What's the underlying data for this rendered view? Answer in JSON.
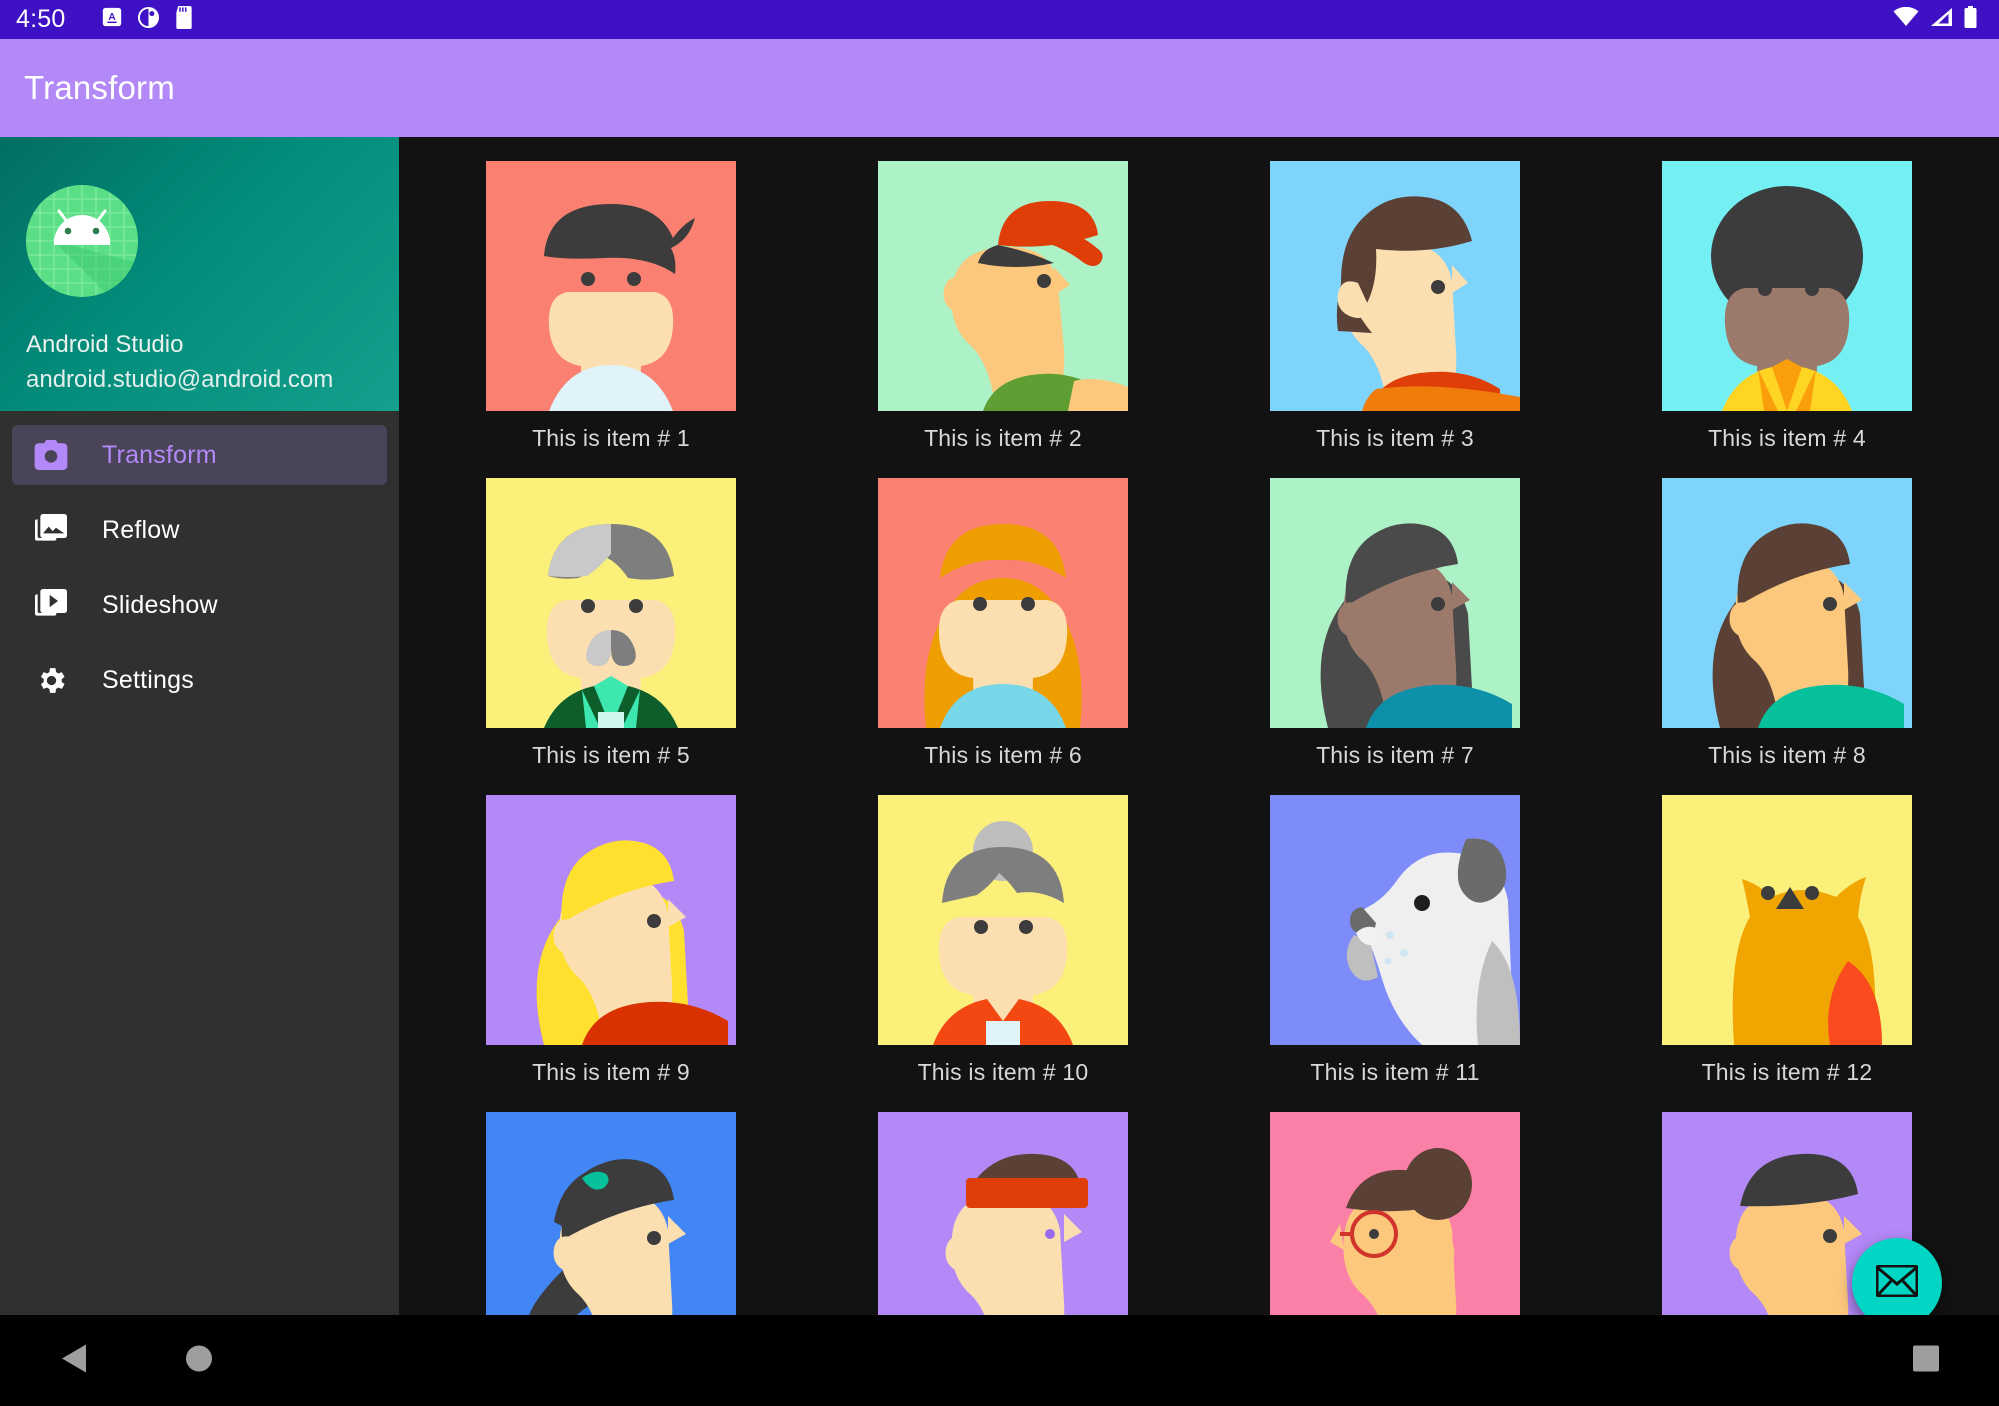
{
  "status_bar": {
    "clock": "4:50",
    "left_icons": [
      "alarm-letter-icon",
      "contrast-circle-icon",
      "sd-card-icon"
    ],
    "right_icons": [
      "wifi-icon",
      "cell-signal-icon",
      "battery-icon"
    ],
    "background_color": "#3F11C4"
  },
  "app_bar": {
    "title": "Transform",
    "background_color": "#B388F7",
    "title_color": "#FFFFFF"
  },
  "drawer": {
    "background_color": "#303030",
    "header": {
      "account_name": "Android Studio",
      "account_email": "android.studio@android.com",
      "logo_icon": "android-studio-logo",
      "gradient_from": "#016E62",
      "gradient_to": "#14A08C"
    },
    "items": [
      {
        "label": "Transform",
        "icon": "camera-icon",
        "selected": true
      },
      {
        "label": "Reflow",
        "icon": "photo-library-icon",
        "selected": false
      },
      {
        "label": "Slideshow",
        "icon": "video-library-icon",
        "selected": false
      },
      {
        "label": "Settings",
        "icon": "gear-icon",
        "selected": false
      }
    ],
    "selected_item_background": "#4A4458",
    "selected_item_color": "#B388F7"
  },
  "grid": {
    "items": [
      {
        "caption": "This is item # 1",
        "bg": "#FA8072",
        "kind": "front-quiff",
        "hair": "#3C3C3C",
        "skin": "#FCDFB0",
        "shirt": "#DFF3F9"
      },
      {
        "caption": "This is item # 2",
        "bg": "#ADF2C7",
        "kind": "profile-cap",
        "hair": "#3C3C3C",
        "skin": "#FCC87E",
        "shirt": "#5E9E32",
        "accent": "#E03E09"
      },
      {
        "caption": "This is item # 3",
        "bg": "#7FD4FB",
        "kind": "profile-bob",
        "hair": "#5B4036",
        "skin": "#FCDFB0",
        "shirt": "#F07C0B",
        "accent": "#E03E09"
      },
      {
        "caption": "This is item # 4",
        "bg": "#74F0F5",
        "kind": "front-afro",
        "hair": "#3C3C3C",
        "skin": "#9C7A6B",
        "shirt": "#FFD524",
        "accent": "#FA9E0C"
      },
      {
        "caption": "This is item # 5",
        "bg": "#FAF07A",
        "kind": "front-mustache",
        "hair": "#7E7E7E",
        "skin": "#FCDFB0",
        "shirt": "#0D5E2A",
        "accent": "#3EE6B0"
      },
      {
        "caption": "This is item # 6",
        "bg": "#FA8072",
        "kind": "front-long",
        "hair": "#EE9E00",
        "skin": "#FCDFB0",
        "shirt": "#77D7E8"
      },
      {
        "caption": "This is item # 7",
        "bg": "#ADF2C7",
        "kind": "profile-long",
        "hair": "#4A4A4A",
        "skin": "#9C7A6B",
        "shirt": "#0E90A8"
      },
      {
        "caption": "This is item # 8",
        "bg": "#7FD4FB",
        "kind": "profile-long",
        "hair": "#5B4036",
        "skin": "#FCC87E",
        "shirt": "#05C09A"
      },
      {
        "caption": "This is item # 9",
        "bg": "#B388F7",
        "kind": "profile-long",
        "hair": "#FFE02E",
        "skin": "#FCDFB0",
        "shirt": "#D93200"
      },
      {
        "caption": "This is item # 10",
        "bg": "#FAF07A",
        "kind": "front-bun",
        "hair": "#7E7E7E",
        "skin": "#FCDFB0",
        "shirt": "#F44813",
        "accent": "#DFF3F9"
      },
      {
        "caption": "This is item # 11",
        "bg": "#7E8CFA",
        "kind": "dog",
        "hair": "#6B6B6B",
        "skin": "#EFEFEF",
        "shirt": "#BFBFBF"
      },
      {
        "caption": "This is item # 12",
        "bg": "#FAF07A",
        "kind": "owl",
        "hair": "#3C3C3C",
        "skin": "#F0A500",
        "shirt": "#FA4B1E"
      },
      {
        "caption": "",
        "bg": "#4285F4",
        "kind": "profile-pony",
        "hair": "#3C3C3C",
        "skin": "#FCDFB0",
        "shirt": "#F44813",
        "accent": "#05C09A"
      },
      {
        "caption": "",
        "bg": "#B388F7",
        "kind": "profile-band",
        "hair": "#5B4036",
        "skin": "#FCDFB0",
        "shirt": "#2A4FBF",
        "accent": "#E03E09"
      },
      {
        "caption": "",
        "bg": "#FA80A8",
        "kind": "profile-monocle",
        "hair": "#5B4036",
        "skin": "#FCC87E",
        "shirt": "#FFE02E",
        "accent": "#D1342B"
      },
      {
        "caption": "",
        "bg": "#B388F7",
        "kind": "profile-short",
        "hair": "#3C3C3C",
        "skin": "#FCC87E",
        "shirt": "#5E9E32"
      }
    ],
    "caption_color": "#D8D8D8",
    "background_color": "#121212"
  },
  "fab": {
    "icon": "envelope-icon",
    "background_color": "#00D6C3",
    "icon_color": "#111111"
  },
  "nav_bar": {
    "background_color": "#000000",
    "buttons": [
      {
        "icon": "back-triangle-icon",
        "name": "back"
      },
      {
        "icon": "home-circle-icon",
        "name": "home"
      },
      {
        "icon": "recents-square-icon",
        "name": "recents"
      }
    ]
  }
}
